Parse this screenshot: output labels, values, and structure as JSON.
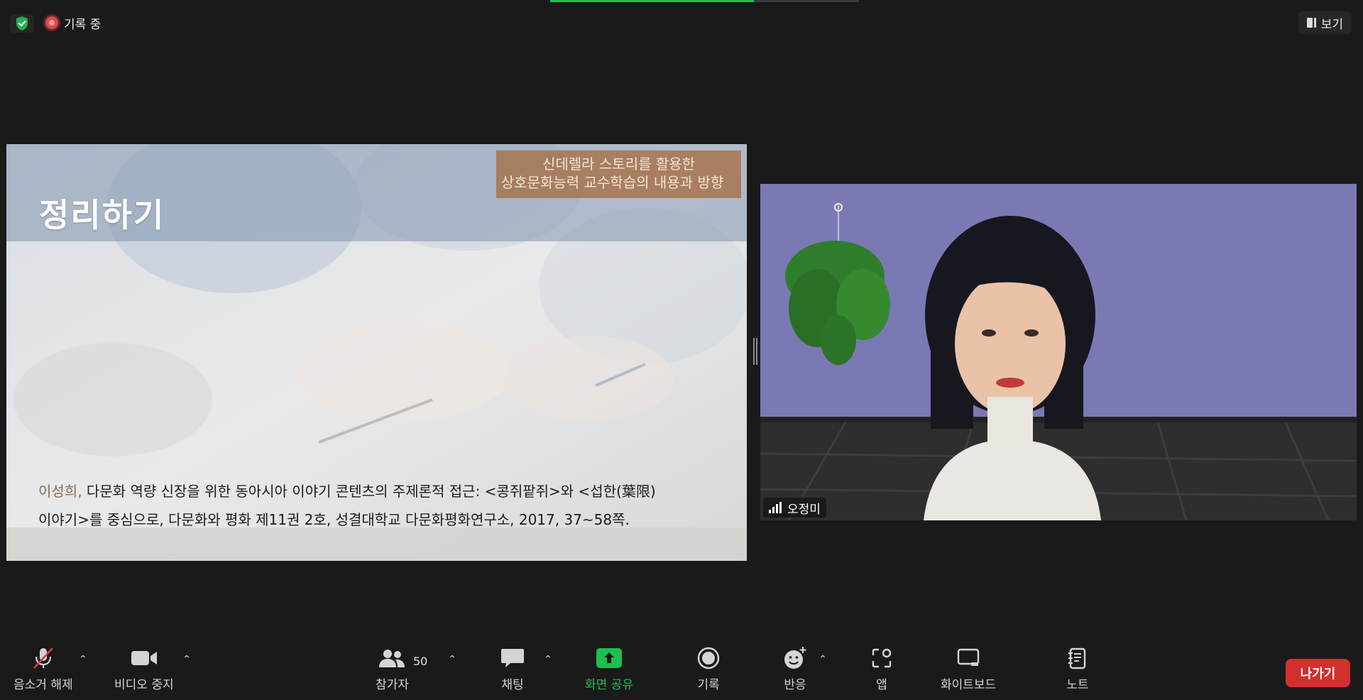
{
  "status": {
    "security_icon": "shield-check-icon",
    "recording_label": "기록 중",
    "recording_color": "#e04848"
  },
  "view_button": {
    "label": "보기"
  },
  "progress": {
    "fraction": 0.66
  },
  "slide": {
    "title": "정리하기",
    "subtitle_line1": "신데렐라 스토리를 활용한",
    "subtitle_line2": "상호문화능력 교수학습의 내용과 방향",
    "citation_author": "이성희,",
    "citation_line1": " 다문화 역량 신장을 위한 동아시아 이야기 콘텐츠의 주제론적 접근: <콩쥐팥쥐>와 <섭한(葉限)",
    "citation_line2": "이야기>를 중심으로, 다문화와 평화 제11권 2호, 성결대학교 다문화평화연구소, 2017, 37~58쪽."
  },
  "participant": {
    "name": "오정미",
    "signal_icon": "signal-bars-icon"
  },
  "toolbar": {
    "unmute_label": "음소거 해제",
    "stop_video_label": "비디오 중지",
    "participants_label": "참가자",
    "participants_count": "50",
    "chat_label": "채팅",
    "share_label": "화면 공유",
    "record_label": "기록",
    "reactions_label": "반응",
    "apps_label": "앱",
    "whiteboard_label": "화이트보드",
    "notes_label": "노트",
    "leave_label": "나가기",
    "share_color": "#1fbf4f",
    "leave_color": "#d32f2f"
  }
}
